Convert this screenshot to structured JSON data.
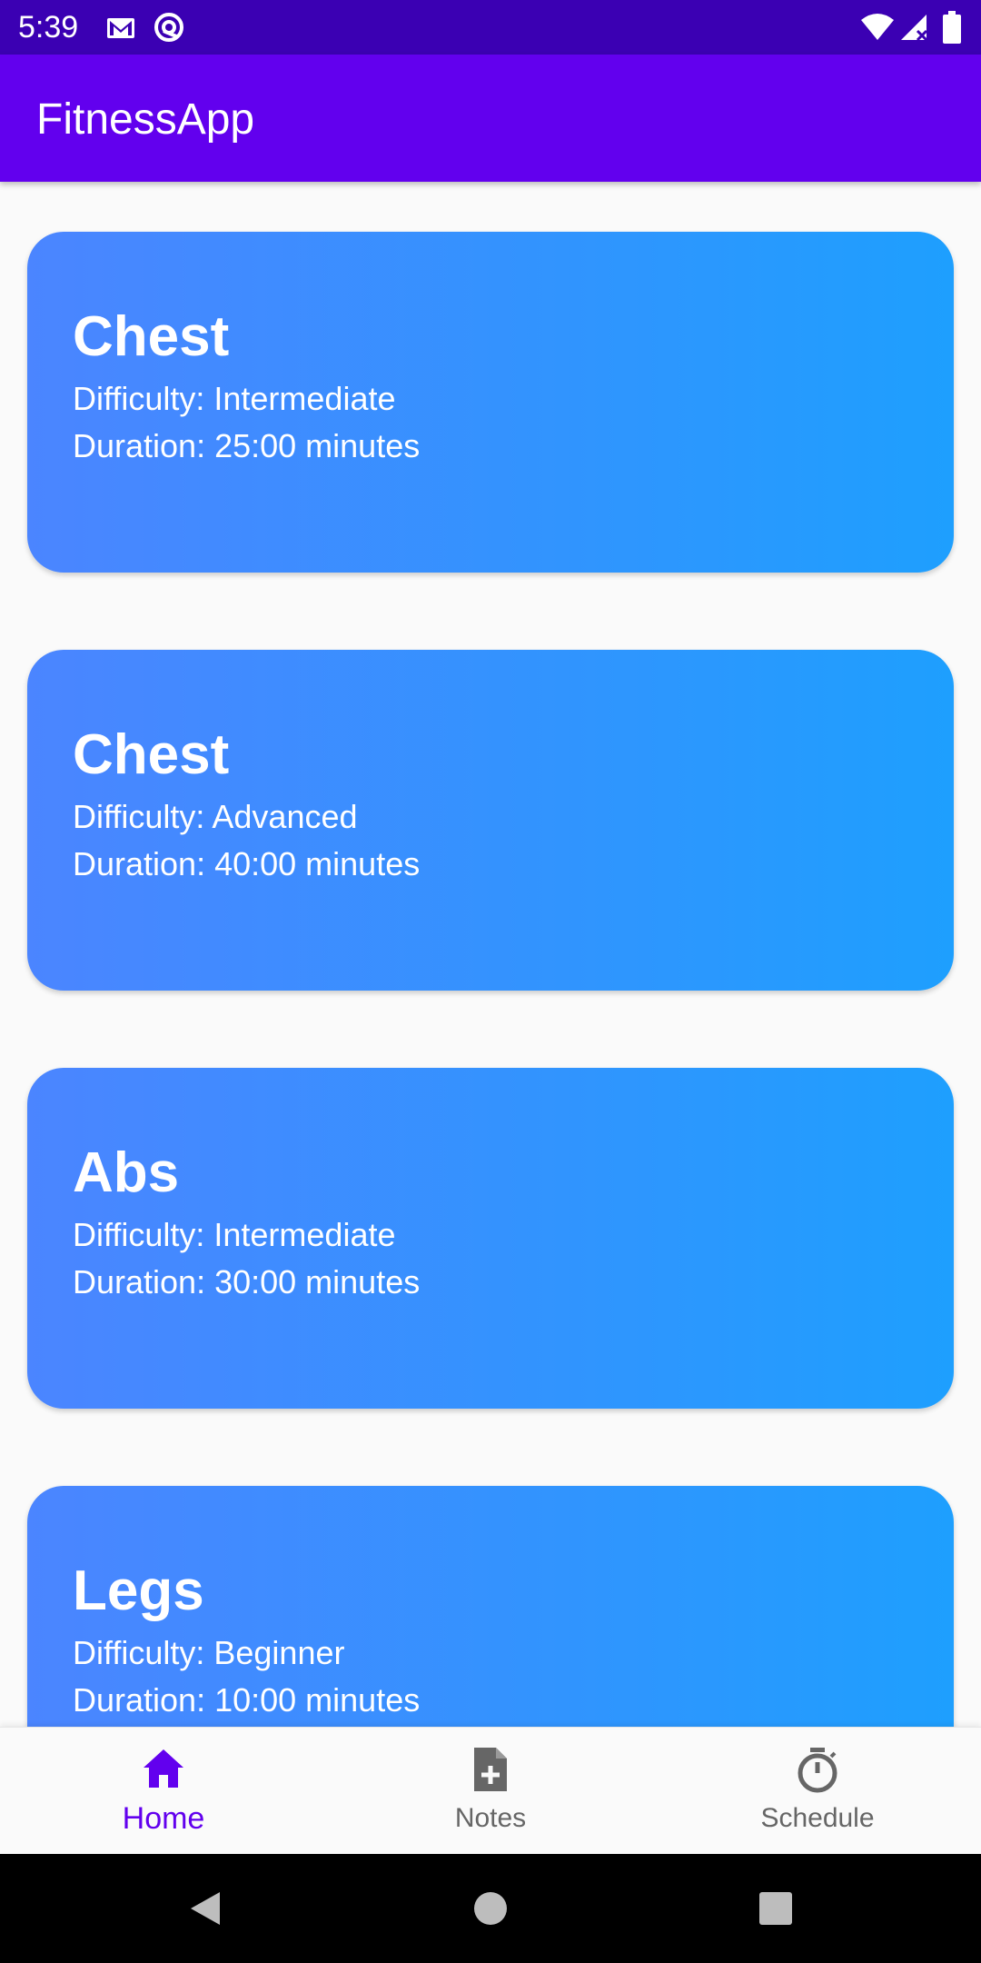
{
  "status_bar": {
    "time": "5:39",
    "left_icons": [
      "gmail-icon",
      "sync-icon"
    ],
    "right_icons": [
      "wifi-icon",
      "signal-icon",
      "battery-icon"
    ],
    "bg_color": "#3b00b3"
  },
  "app_bar": {
    "title": "FitnessApp",
    "bg_color": "#6200ee"
  },
  "workouts": [
    {
      "title": "Chest",
      "difficulty": "Difficulty: Intermediate",
      "duration": "Duration: 25:00 minutes"
    },
    {
      "title": "Chest",
      "difficulty": "Difficulty: Advanced",
      "duration": "Duration: 40:00 minutes"
    },
    {
      "title": "Abs",
      "difficulty": "Difficulty: Intermediate",
      "duration": "Duration: 30:00 minutes"
    },
    {
      "title": "Legs",
      "difficulty": "Difficulty: Beginner",
      "duration": "Duration: 10:00 minutes"
    }
  ],
  "card_gradient": [
    "#4b85ff",
    "#1e9ffe"
  ],
  "bottom_nav": {
    "items": [
      {
        "label": "Home",
        "icon": "home-icon",
        "active": true
      },
      {
        "label": "Notes",
        "icon": "note-add-icon",
        "active": false
      },
      {
        "label": "Schedule",
        "icon": "timer-icon",
        "active": false
      }
    ],
    "active_color": "#6200ee",
    "inactive_color": "#666666"
  },
  "system_nav": {
    "buttons": [
      "back-icon",
      "home-circle-icon",
      "recents-icon"
    ]
  }
}
